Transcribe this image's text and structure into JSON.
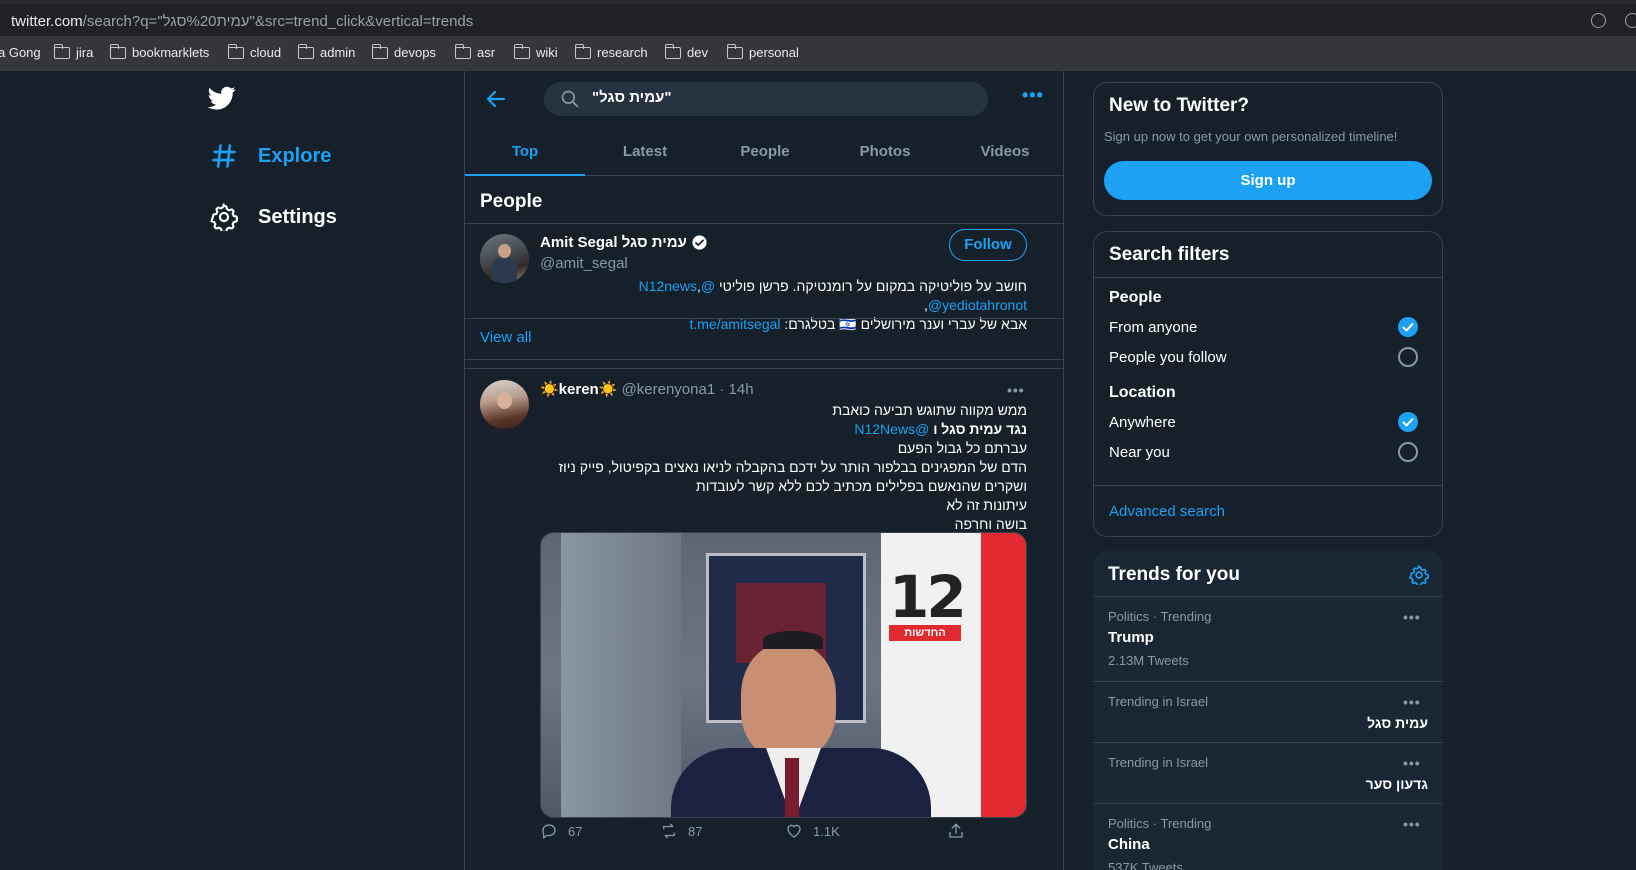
{
  "browser": {
    "url_host": "twitter.com",
    "url_path": "/search?q=\"עמית%20סגל\"&src=trend_click&vertical=trends",
    "bookmarks": [
      "a Gong",
      "jira",
      "bookmarklets",
      "cloud",
      "admin",
      "devops",
      "asr",
      "wiki",
      "research",
      "dev",
      "personal"
    ]
  },
  "nav": {
    "logo": "twitter-bird-icon",
    "items": [
      {
        "label": "Explore",
        "icon": "hashtag-icon",
        "active": true
      },
      {
        "label": "Settings",
        "icon": "gear-icon",
        "active": false
      }
    ]
  },
  "search": {
    "query": "\"עמית סגל\"",
    "tabs": [
      "Top",
      "Latest",
      "People",
      "Photos",
      "Videos"
    ],
    "active_tab": "Top"
  },
  "people": {
    "heading": "People",
    "user": {
      "name": "Amit Segal עמית סגל",
      "handle": "@amit_segal",
      "follow_label": "Follow",
      "bio_line1_text": "חושב על פוליטיקה במקום על רומנטיקה. פרשן פוליטי",
      "bio_mention1": "@N12news",
      "bio_mention2": "@yediotahronot",
      "bio_line2_text": "אבא של עברי וענר מירושלים 🇮🇱 בטלגרם:",
      "bio_link": "t.me/amitsegal"
    },
    "view_all": "View all"
  },
  "tweet": {
    "name": "☀️keren☀️",
    "handle": "@kerenyona1",
    "time": "14h",
    "lines": [
      "ממש מקווה שתוגש תביעה כואבת",
      "נגד עמית סגל ו",
      "עברתם כל גבול הפעם",
      "הדם של המפגינים בבלפור הותר על ידכם בהקבלה לניאו נאצים בקפיטול, פייק ניוז",
      "ושקרים שהנאשם בפלילים מכתיב לכם ללא קשר לעובדות",
      "עיתונות זה לא",
      "בושה וחרפה"
    ],
    "mention": "@N12News",
    "bold_name": "עמית סגל",
    "image_logo": "12",
    "image_caption": "החדשות",
    "reply_count": "67",
    "retweet_count": "87",
    "like_count": "1.1K"
  },
  "signup": {
    "title": "New to Twitter?",
    "text": "Sign up now to get your own personalized timeline!",
    "button": "Sign up"
  },
  "filters": {
    "title": "Search filters",
    "people_heading": "People",
    "people_options": [
      {
        "label": "From anyone",
        "selected": true
      },
      {
        "label": "People you follow",
        "selected": false
      }
    ],
    "location_heading": "Location",
    "location_options": [
      {
        "label": "Anywhere",
        "selected": true
      },
      {
        "label": "Near you",
        "selected": false
      }
    ],
    "advanced": "Advanced search"
  },
  "trends": {
    "title": "Trends for you",
    "items": [
      {
        "context": "Politics · Trending",
        "name": "Trump",
        "count": "2.13M Tweets"
      },
      {
        "context": "Trending in Israel",
        "name": "עמית סגל",
        "count": ""
      },
      {
        "context": "Trending in Israel",
        "name": "גדעון סער",
        "count": ""
      },
      {
        "context": "Politics · Trending",
        "name": "China",
        "count": "537K Tweets"
      }
    ]
  },
  "colors": {
    "background": "#15202b",
    "card": "#192734",
    "accent": "#1da1f2",
    "muted": "#8899a6",
    "border": "#38444d"
  }
}
